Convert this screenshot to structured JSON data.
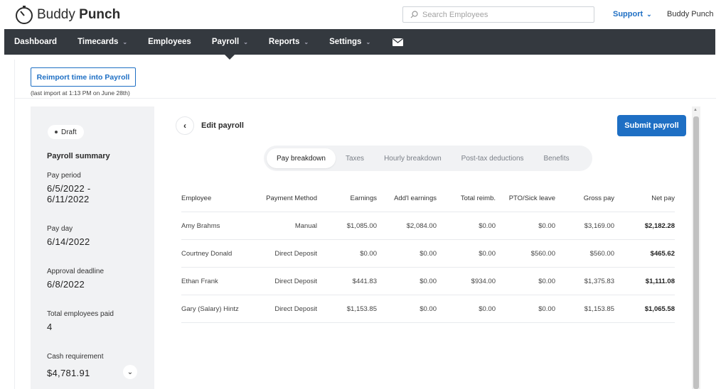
{
  "app": {
    "name_light": "Buddy",
    "name_bold": "Punch"
  },
  "search": {
    "placeholder": "Search Employees"
  },
  "header": {
    "support_label": "Support",
    "account_name": "Buddy Punch"
  },
  "nav": {
    "items": [
      {
        "label": "Dashboard",
        "has_menu": false,
        "active": false
      },
      {
        "label": "Timecards",
        "has_menu": true,
        "active": false
      },
      {
        "label": "Employees",
        "has_menu": false,
        "active": false
      },
      {
        "label": "Payroll",
        "has_menu": true,
        "active": true
      },
      {
        "label": "Reports",
        "has_menu": true,
        "active": false
      },
      {
        "label": "Settings",
        "has_menu": true,
        "active": false
      }
    ]
  },
  "reimport": {
    "button_label": "Reimport time into Payroll",
    "note": "(last import at 1:13 PM on June 28th)"
  },
  "summary": {
    "status": "Draft",
    "title": "Payroll summary",
    "pay_period_label": "Pay period",
    "pay_period_line1": "6/5/2022 -",
    "pay_period_line2": "6/11/2022",
    "pay_day_label": "Pay day",
    "pay_day": "6/14/2022",
    "approval_label": "Approval deadline",
    "approval": "6/8/2022",
    "employees_label": "Total employees paid",
    "employees": "4",
    "cash_label": "Cash requirement",
    "cash": "$4,781.91"
  },
  "main": {
    "edit_title": "Edit payroll",
    "submit_label": "Submit payroll",
    "tabs": [
      "Pay breakdown",
      "Taxes",
      "Hourly breakdown",
      "Post-tax deductions",
      "Benefits"
    ],
    "active_tab": 0
  },
  "table": {
    "columns": [
      "Employee",
      "Payment Method",
      "Earnings",
      "Add'l earnings",
      "Total reimb.",
      "PTO/Sick leave",
      "Gross pay",
      "Net pay"
    ],
    "rows": [
      [
        "Amy Brahms",
        "Manual",
        "$1,085.00",
        "$2,084.00",
        "$0.00",
        "$0.00",
        "$3,169.00",
        "$2,182.28"
      ],
      [
        "Courtney Donald",
        "Direct Deposit",
        "$0.00",
        "$0.00",
        "$0.00",
        "$560.00",
        "$560.00",
        "$465.62"
      ],
      [
        "Ethan Frank",
        "Direct Deposit",
        "$441.83",
        "$0.00",
        "$934.00",
        "$0.00",
        "$1,375.83",
        "$1,111.08"
      ],
      [
        "Gary (Salary) Hintz",
        "Direct Deposit",
        "$1,153.85",
        "$0.00",
        "$0.00",
        "$0.00",
        "$1,153.85",
        "$1,065.58"
      ]
    ]
  },
  "colors": {
    "accent": "#1e6fc4",
    "nav_bg": "#34393f",
    "sidebar_bg": "#f1f2f4"
  },
  "icons": {
    "logo": "stopwatch-icon",
    "search": "search-icon",
    "mail": "envelope-icon",
    "back": "chevron-left-icon",
    "expand": "chevron-down-icon"
  }
}
